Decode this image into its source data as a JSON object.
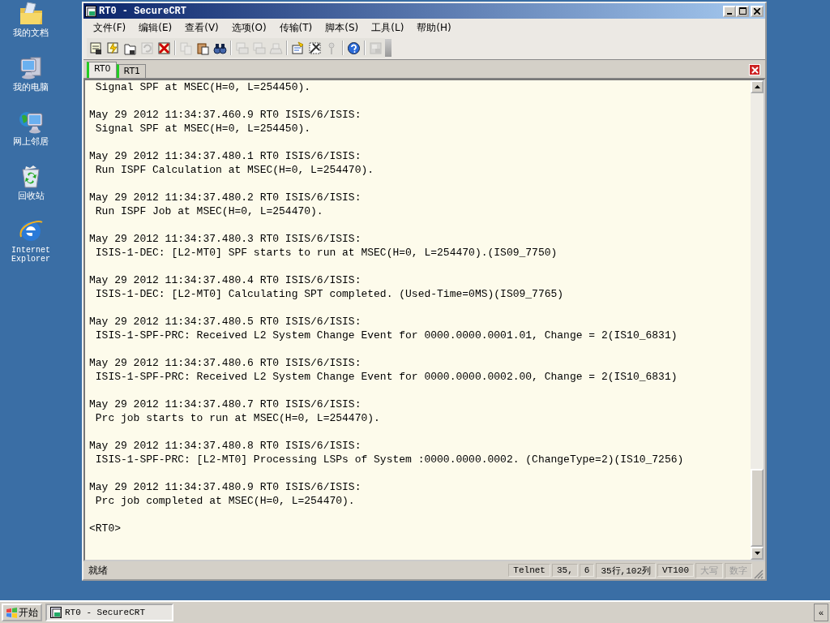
{
  "desktop_icons": [
    {
      "kind": "folder",
      "label": "我的文档"
    },
    {
      "kind": "computer",
      "label": "我的电脑"
    },
    {
      "kind": "network",
      "label": "网上邻居"
    },
    {
      "kind": "recycle",
      "label": "回收站"
    },
    {
      "kind": "browser",
      "label": "Internet Explorer"
    }
  ],
  "window": {
    "title": "RT0 - SecureCRT"
  },
  "menu": [
    "文件(F)",
    "编辑(E)",
    "查看(V)",
    "选项(O)",
    "传输(T)",
    "脚本(S)",
    "工具(L)",
    "帮助(H)"
  ],
  "toolbar": [
    {
      "kind": "connect",
      "disabled": false
    },
    {
      "kind": "quick",
      "disabled": false
    },
    {
      "kind": "tab",
      "disabled": false
    },
    {
      "kind": "reconnect",
      "disabled": true
    },
    {
      "kind": "disconnect",
      "disabled": false
    },
    {
      "kind": "sep"
    },
    {
      "kind": "copy",
      "disabled": true
    },
    {
      "kind": "paste",
      "disabled": false
    },
    {
      "kind": "find",
      "disabled": false
    },
    {
      "kind": "sep"
    },
    {
      "kind": "print",
      "disabled": true
    },
    {
      "kind": "print",
      "disabled": true
    },
    {
      "kind": "printer",
      "disabled": true
    },
    {
      "kind": "sep"
    },
    {
      "kind": "options",
      "disabled": false
    },
    {
      "kind": "map",
      "disabled": false
    },
    {
      "kind": "key",
      "disabled": true
    },
    {
      "kind": "sep"
    },
    {
      "kind": "help",
      "disabled": false
    },
    {
      "kind": "sep"
    },
    {
      "kind": "sftp",
      "disabled": true
    }
  ],
  "tabs": [
    {
      "label": "RT0",
      "selected": true
    },
    {
      "label": "RT1",
      "selected": false
    }
  ],
  "terminal": {
    "entries": [
      {
        "message": " Signal SPF at MSEC(H=0, L=254450)."
      },
      {
        "header": "May 29 2012 11:34:37.460.9 RT0 ISIS/6/ISIS:",
        "message": " Signal SPF at MSEC(H=0, L=254450)."
      },
      {
        "header": "May 29 2012 11:34:37.480.1 RT0 ISIS/6/ISIS:",
        "message": " Run ISPF Calculation at MSEC(H=0, L=254470)."
      },
      {
        "header": "May 29 2012 11:34:37.480.2 RT0 ISIS/6/ISIS:",
        "message": " Run ISPF Job at MSEC(H=0, L=254470)."
      },
      {
        "header": "May 29 2012 11:34:37.480.3 RT0 ISIS/6/ISIS:",
        "message": " ISIS-1-DEC: [L2-MT0] SPF starts to run at MSEC(H=0, L=254470).(IS09_7750)"
      },
      {
        "header": "May 29 2012 11:34:37.480.4 RT0 ISIS/6/ISIS:",
        "message": " ISIS-1-DEC: [L2-MT0] Calculating SPT completed. (Used-Time=0MS)(IS09_7765)"
      },
      {
        "header": "May 29 2012 11:34:37.480.5 RT0 ISIS/6/ISIS:",
        "message": " ISIS-1-SPF-PRC: Received L2 System Change Event for 0000.0000.0001.01, Change = 2(IS10_6831)"
      },
      {
        "header": "May 29 2012 11:34:37.480.6 RT0 ISIS/6/ISIS:",
        "message": " ISIS-1-SPF-PRC: Received L2 System Change Event for 0000.0000.0002.00, Change = 2(IS10_6831)"
      },
      {
        "header": "May 29 2012 11:34:37.480.7 RT0 ISIS/6/ISIS:",
        "message": " Prc job starts to run at MSEC(H=0, L=254470)."
      },
      {
        "header": "May 29 2012 11:34:37.480.8 RT0 ISIS/6/ISIS:",
        "message": " ISIS-1-SPF-PRC: [L2-MT0] Processing LSPs of System :0000.0000.0002. (ChangeType=2)(IS10_7256)"
      },
      {
        "header": "May 29 2012 11:34:37.480.9 RT0 ISIS/6/ISIS:",
        "message": " Prc job completed at MSEC(H=0, L=254470)."
      }
    ],
    "prompt": "<RT0>"
  },
  "status_bar": {
    "status": "就绪",
    "panes": [
      {
        "text": "Telnet",
        "disabled": false
      },
      {
        "text": "35,",
        "disabled": false
      },
      {
        "text": "6",
        "disabled": false
      },
      {
        "text": "35行,102列",
        "disabled": false
      },
      {
        "text": "VT100",
        "disabled": false
      },
      {
        "text": "大写",
        "disabled": true
      },
      {
        "text": "数字",
        "disabled": true
      }
    ]
  },
  "taskbar": {
    "start": "开始",
    "tasks": [
      {
        "label": "RT0 - SecureCRT",
        "selected": true
      }
    ],
    "tray_toggle": "«"
  }
}
